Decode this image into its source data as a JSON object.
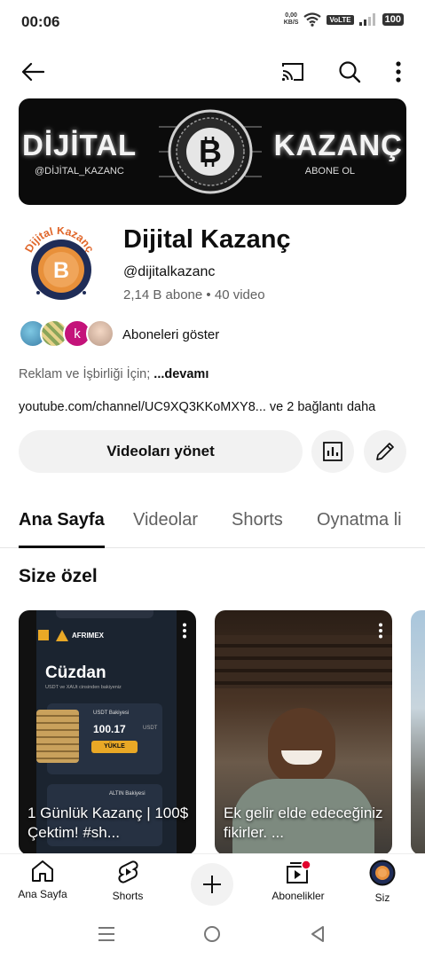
{
  "status": {
    "time": "00:06",
    "net_speed_value": "0,00",
    "net_speed_unit": "KB/S",
    "volte": "VoLTE",
    "battery": "100"
  },
  "top_bar": {
    "icons": [
      "back-arrow-icon",
      "cast-icon",
      "search-icon",
      "more-vert-icon"
    ]
  },
  "banner": {
    "left_text": "DİJİTAL",
    "right_text": "KAZANÇ",
    "handle": "@DİJİTAL_KAZANC",
    "subscribe_text": "ABONE OL"
  },
  "avatar": {
    "arc_text": "Dijital Kazanç",
    "colors": {
      "ring": "#1f2c57",
      "coin": "#e8903a",
      "arc_text": "#e0662a"
    }
  },
  "channel": {
    "name": "Dijital Kazanç",
    "handle": "@dijitalkazanc",
    "subscribers": "2,14 B abone",
    "separator": "•",
    "videos": "40 video"
  },
  "subscribers_row": {
    "label": "Aboneleri göster",
    "avatar_letter": "k"
  },
  "description": {
    "text": "Reklam ve İşbirliği İçin; ",
    "more": "...devamı"
  },
  "links": {
    "text": "youtube.com/channel/UC9XQ3KKoMXY8...",
    "more": " ve 2 bağlantı daha"
  },
  "actions": {
    "manage_videos": "Videoları yönet",
    "analytics_icon": "analytics-icon",
    "edit_icon": "pencil-icon"
  },
  "tabs": [
    {
      "label": "Ana Sayfa",
      "active": true
    },
    {
      "label": "Videolar",
      "active": false
    },
    {
      "label": "Shorts",
      "active": false
    },
    {
      "label": "Oynatma li",
      "active": false
    }
  ],
  "section": {
    "title": "Size özel"
  },
  "shorts": [
    {
      "title": "1 Günlük Kazanç | 100$ Çektim! #sh...",
      "brand": "AFRIMEX",
      "wallet_title": "Cüzdan",
      "wallet_sub": "USDT ve XAUt cinsinden bakiyeniz",
      "balance_label": "USDT Bakiyesi",
      "balance": "100.17",
      "balance_unit": "USDT",
      "load_button": "YÜKLE",
      "gold_label": "ALTIN Bakiyesi"
    },
    {
      "title": "Ek gelir elde edeceğiniz fikirler. ..."
    }
  ],
  "bottom_nav": [
    {
      "label": "Ana Sayfa",
      "icon": "home-icon"
    },
    {
      "label": "Shorts",
      "icon": "shorts-icon"
    },
    {
      "label": "",
      "icon": "plus-icon"
    },
    {
      "label": "Abonelikler",
      "icon": "subscriptions-icon"
    },
    {
      "label": "Siz",
      "icon": "profile-avatar-icon"
    }
  ],
  "system_nav": [
    "recents-icon",
    "home-circle-icon",
    "back-triangle-icon"
  ]
}
